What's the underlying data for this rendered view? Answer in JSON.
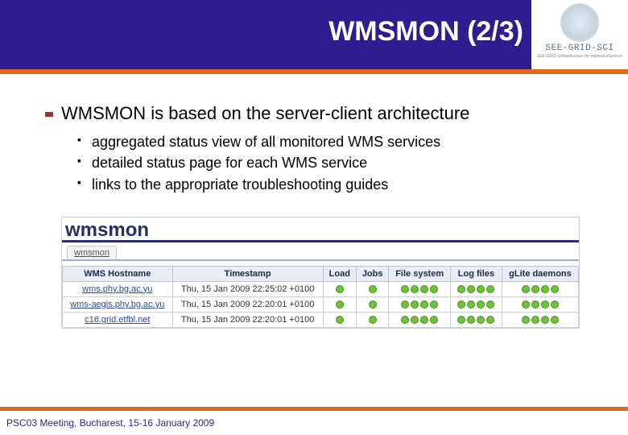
{
  "header": {
    "title": "WMSMON (2/3)",
    "logo_text": "SEE-GRID-SCI",
    "logo_sub": "SEE-GRID eInfrastructure for regional eScience"
  },
  "bullets": {
    "main": "WMSMON is based on the server-client architecture",
    "subs": [
      "aggregated status view of all monitored WMS services",
      "detailed status page for each WMS service",
      "links to the appropriate troubleshooting guides"
    ]
  },
  "screenshot": {
    "logo": "wmsmon",
    "tab": "wmsmon",
    "headers": [
      "WMS Hostname",
      "Timestamp",
      "Load",
      "Jobs",
      "File system",
      "Log files",
      "gLite daemons"
    ],
    "rows": [
      {
        "host": "wms.phy.bg.ac.yu",
        "ts": "Thu, 15 Jan 2009 22:25:02 +0100",
        "load": 1,
        "jobs": 1,
        "fs": 4,
        "log": 4,
        "daemons": 4
      },
      {
        "host": "wms-aegis.phy.bg.ac.yu",
        "ts": "Thu, 15 Jan 2009 22:20:01 +0100",
        "load": 1,
        "jobs": 1,
        "fs": 4,
        "log": 4,
        "daemons": 4
      },
      {
        "host": "c16.grid.etfbl.net",
        "ts": "Thu, 15 Jan 2009 22:20:01 +0100",
        "load": 1,
        "jobs": 1,
        "fs": 4,
        "log": 4,
        "daemons": 4
      }
    ]
  },
  "footer": "PSC03 Meeting, Bucharest, 15-16 January 2009"
}
